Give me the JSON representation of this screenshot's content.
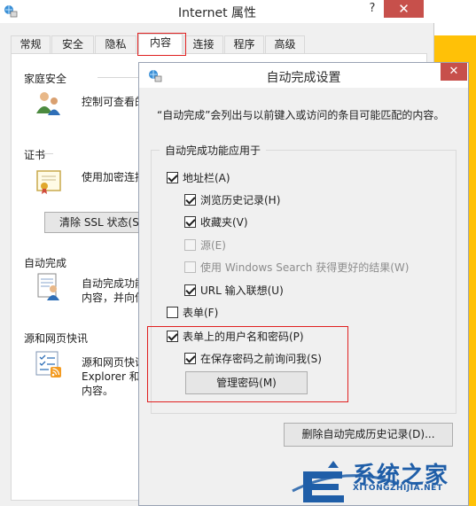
{
  "background_window": {
    "title": "Internet 属性",
    "help_glyph": "?",
    "close_glyph": "✕",
    "tabs": [
      {
        "label": "常规"
      },
      {
        "label": "安全"
      },
      {
        "label": "隐私"
      },
      {
        "label": "内容",
        "active": true
      },
      {
        "label": "连接"
      },
      {
        "label": "程序"
      },
      {
        "label": "高级"
      }
    ],
    "sections": {
      "family_safety": {
        "title": "家庭安全",
        "text": "控制可查看的",
        "icon": "family-users-icon"
      },
      "certificates": {
        "title": "证书",
        "text": "使用加密连接",
        "button": "清除 SSL 状态(S)",
        "icon": "certificate-icon"
      },
      "autocomplete": {
        "title": "自动完成",
        "text_line1": "自动完成功能",
        "text_line2": "内容，并向你",
        "icon": "form-user-icon"
      },
      "feeds": {
        "title": "源和网页快讯",
        "text_line1": "源和网页快讯",
        "text_line2": "Explorer 和",
        "text_line3": "内容。",
        "icon": "feed-icon"
      }
    }
  },
  "dialog": {
    "title": "自动完成设置",
    "close_glyph": "✕",
    "description": "“自动完成”会列出与以前键入或访问的条目可能匹配的内容。",
    "group_title": "自动完成功能应用于",
    "options": {
      "address_bar": {
        "label": "地址栏(A)",
        "checked": true
      },
      "browsing_history": {
        "label": "浏览历史记录(H)",
        "checked": true
      },
      "favorites": {
        "label": "收藏夹(V)",
        "checked": true
      },
      "feeds": {
        "label": "源(E)",
        "checked": false,
        "disabled": true
      },
      "windows_search": {
        "label": "使用 Windows Search 获得更好的结果(W)",
        "checked": false,
        "disabled": true
      },
      "url_suggestions": {
        "label": "URL 输入联想(U)",
        "checked": true
      },
      "forms": {
        "label": "表单(F)",
        "checked": false
      },
      "usernames_passwords": {
        "label": "表单上的用户名和密码(P)",
        "checked": true
      },
      "ask_before_saving": {
        "label": "在保存密码之前询问我(S)",
        "checked": true
      }
    },
    "manage_passwords_button": "管理密码(M)",
    "delete_history_button": "删除自动完成历史记录(D)..."
  },
  "watermark": {
    "text": "系统之家",
    "url": "XITONGZHIJIA.NET"
  },
  "colors": {
    "close_red": "#c7504b",
    "highlight_red": "#e02020",
    "watermark_blue": "#1f5ea8",
    "strip_yellow": "#ffc107"
  }
}
